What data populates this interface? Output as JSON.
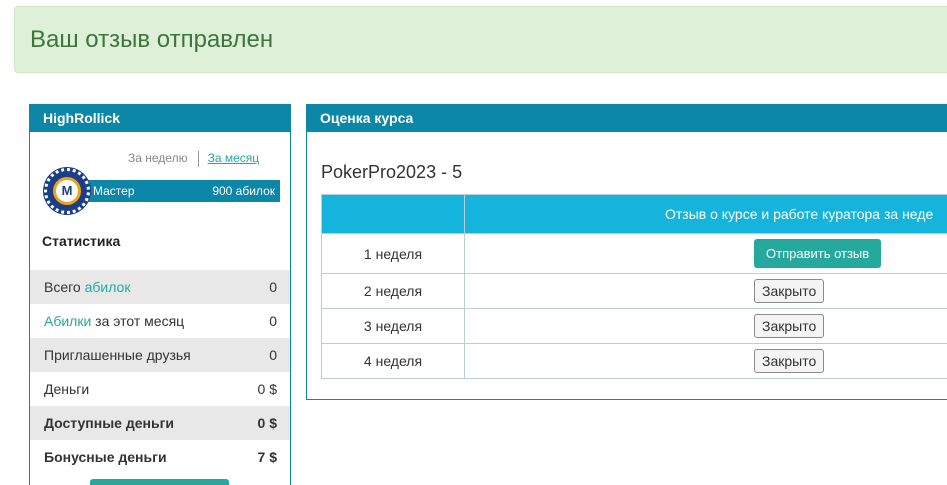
{
  "alert": {
    "text": "Ваш отзыв отправлен"
  },
  "profile": {
    "username": "HighRollick",
    "period_week": "За неделю",
    "period_month": "За месяц",
    "rank_badge_letter": "M",
    "rank_name": "Мастер",
    "rank_value": "900 абилок",
    "stats_title": "Статистика",
    "stats": [
      {
        "prefix": "Всего ",
        "link": "абилок",
        "suffix": "",
        "value": "0"
      },
      {
        "prefix": "",
        "link": "Абилки",
        "suffix": " за этот месяц",
        "value": "0"
      },
      {
        "prefix": "Приглашенные друзья",
        "link": "",
        "suffix": "",
        "value": "0"
      },
      {
        "prefix": "Деньги",
        "link": "",
        "suffix": "",
        "value": "0 $"
      },
      {
        "prefix": "Доступные деньги",
        "link": "",
        "suffix": "",
        "value": "0 $"
      },
      {
        "prefix": "Бонусные деньги",
        "link": "",
        "suffix": "",
        "value": "7 $"
      }
    ]
  },
  "course": {
    "panel_title": "Оценка курса",
    "title": "PokerPro2023 - 5",
    "table": {
      "header_week": "",
      "header_review": "Отзыв о курсе и работе куратора за неде",
      "rows": [
        {
          "week": "1 неделя",
          "action": "Отправить отзыв"
        },
        {
          "week": "2 неделя",
          "action": "Закрыто"
        },
        {
          "week": "3 неделя",
          "action": "Закрыто"
        },
        {
          "week": "4 неделя",
          "action": "Закрыто"
        }
      ]
    }
  },
  "colors": {
    "panel_header": "#0d87a8",
    "table_header": "#14b4dc",
    "accent_green": "#25a99c",
    "alert_bg": "#dff0d8",
    "alert_text": "#3c763d"
  }
}
